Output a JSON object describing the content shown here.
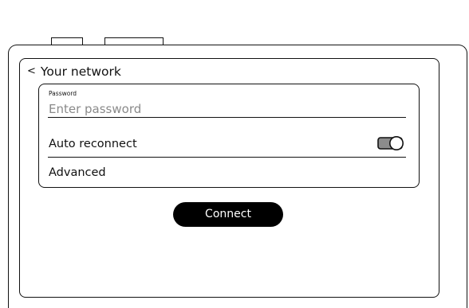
{
  "header": {
    "back_symbol": "<",
    "title": "Your network"
  },
  "password": {
    "label": "Password",
    "placeholder": "Enter password",
    "value": ""
  },
  "auto_reconnect": {
    "label": "Auto reconnect",
    "enabled": false,
    "icon": "toggle-switch-icon"
  },
  "advanced": {
    "label": "Advanced"
  },
  "connect_button": {
    "label": "Connect"
  },
  "colors": {
    "outline": "#111111",
    "button_bg": "#000000",
    "button_text": "#ffffff",
    "placeholder": "#8a8a8a"
  }
}
